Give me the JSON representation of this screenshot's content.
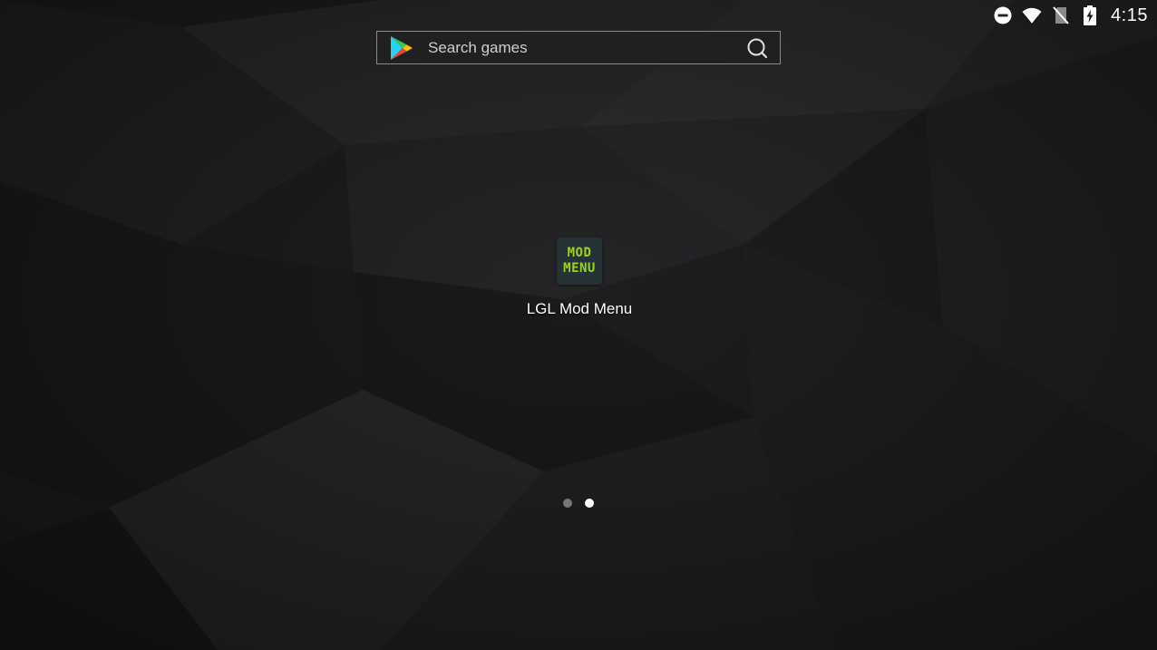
{
  "status_bar": {
    "icons": [
      "do-not-disturb-icon",
      "wifi-icon",
      "no-sim-icon",
      "battery-charging-icon"
    ],
    "time": "4:15"
  },
  "search": {
    "placeholder": "Search games",
    "value": ""
  },
  "home": {
    "apps": [
      {
        "label": "LGL Mod Menu",
        "icon_text_line1": "MOD",
        "icon_text_line2": "MENU",
        "icon_text_color": "#9bd61c",
        "icon_bg_color": "#253236"
      }
    ],
    "page_indicator": {
      "total_pages": 2,
      "current_page": 2
    }
  },
  "colors": {
    "wallpaper_base": "#1d1d1f",
    "search_bg": "#202022",
    "search_border": "#8a8a8a",
    "text_primary": "#ffffff"
  }
}
